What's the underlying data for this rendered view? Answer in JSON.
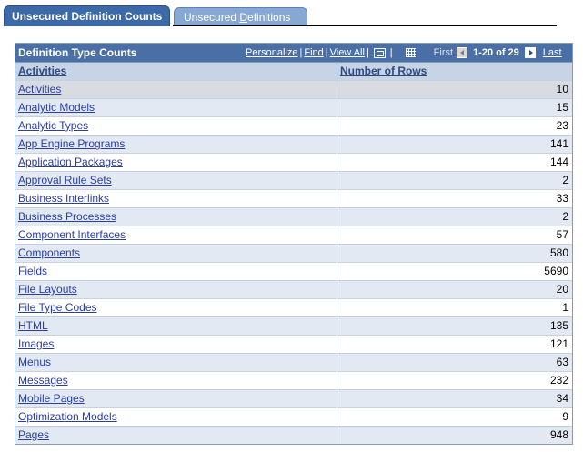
{
  "tabs": [
    {
      "label": "Unsecured Definition Counts",
      "active": true
    },
    {
      "label_pre": "Unsecured ",
      "label_u": "D",
      "label_post": "efinitions",
      "active": false
    }
  ],
  "grid": {
    "title": "Definition Type Counts",
    "nav": {
      "personalize": "Personalize",
      "find": "Find",
      "view_all": "View All",
      "sep": "|",
      "first": "First",
      "range": "1-20 of 29",
      "last": "Last"
    },
    "columns": {
      "col1": "Activities",
      "col2": "Number of Rows"
    },
    "rows": [
      {
        "name": "Activities",
        "count": "10"
      },
      {
        "name": "Analytic Models",
        "count": "15"
      },
      {
        "name": "Analytic Types",
        "count": "23"
      },
      {
        "name": "App Engine Programs",
        "count": "141"
      },
      {
        "name": "Application Packages",
        "count": "144"
      },
      {
        "name": "Approval Rule Sets",
        "count": "2"
      },
      {
        "name": "Business Interlinks",
        "count": "33"
      },
      {
        "name": "Business Processes",
        "count": "2"
      },
      {
        "name": "Component Interfaces",
        "count": "57"
      },
      {
        "name": "Components",
        "count": "580"
      },
      {
        "name": "Fields",
        "count": "5690"
      },
      {
        "name": "File Layouts",
        "count": "20"
      },
      {
        "name": "File Type Codes",
        "count": "1"
      },
      {
        "name": "HTML",
        "count": "135"
      },
      {
        "name": "Images",
        "count": "121"
      },
      {
        "name": "Menus",
        "count": "63"
      },
      {
        "name": "Messages",
        "count": "232"
      },
      {
        "name": "Mobile Pages",
        "count": "34"
      },
      {
        "name": "Optimization Models",
        "count": "9"
      },
      {
        "name": "Pages",
        "count": "948"
      }
    ]
  },
  "colors": {
    "tab_active": "#3c6aa8",
    "tab_inactive": "#88a8d4",
    "grid_header": "#496fa6",
    "col_header": "#c6d4e6",
    "row_alt": "#e3e9f2",
    "link": "#2a3ea0"
  }
}
